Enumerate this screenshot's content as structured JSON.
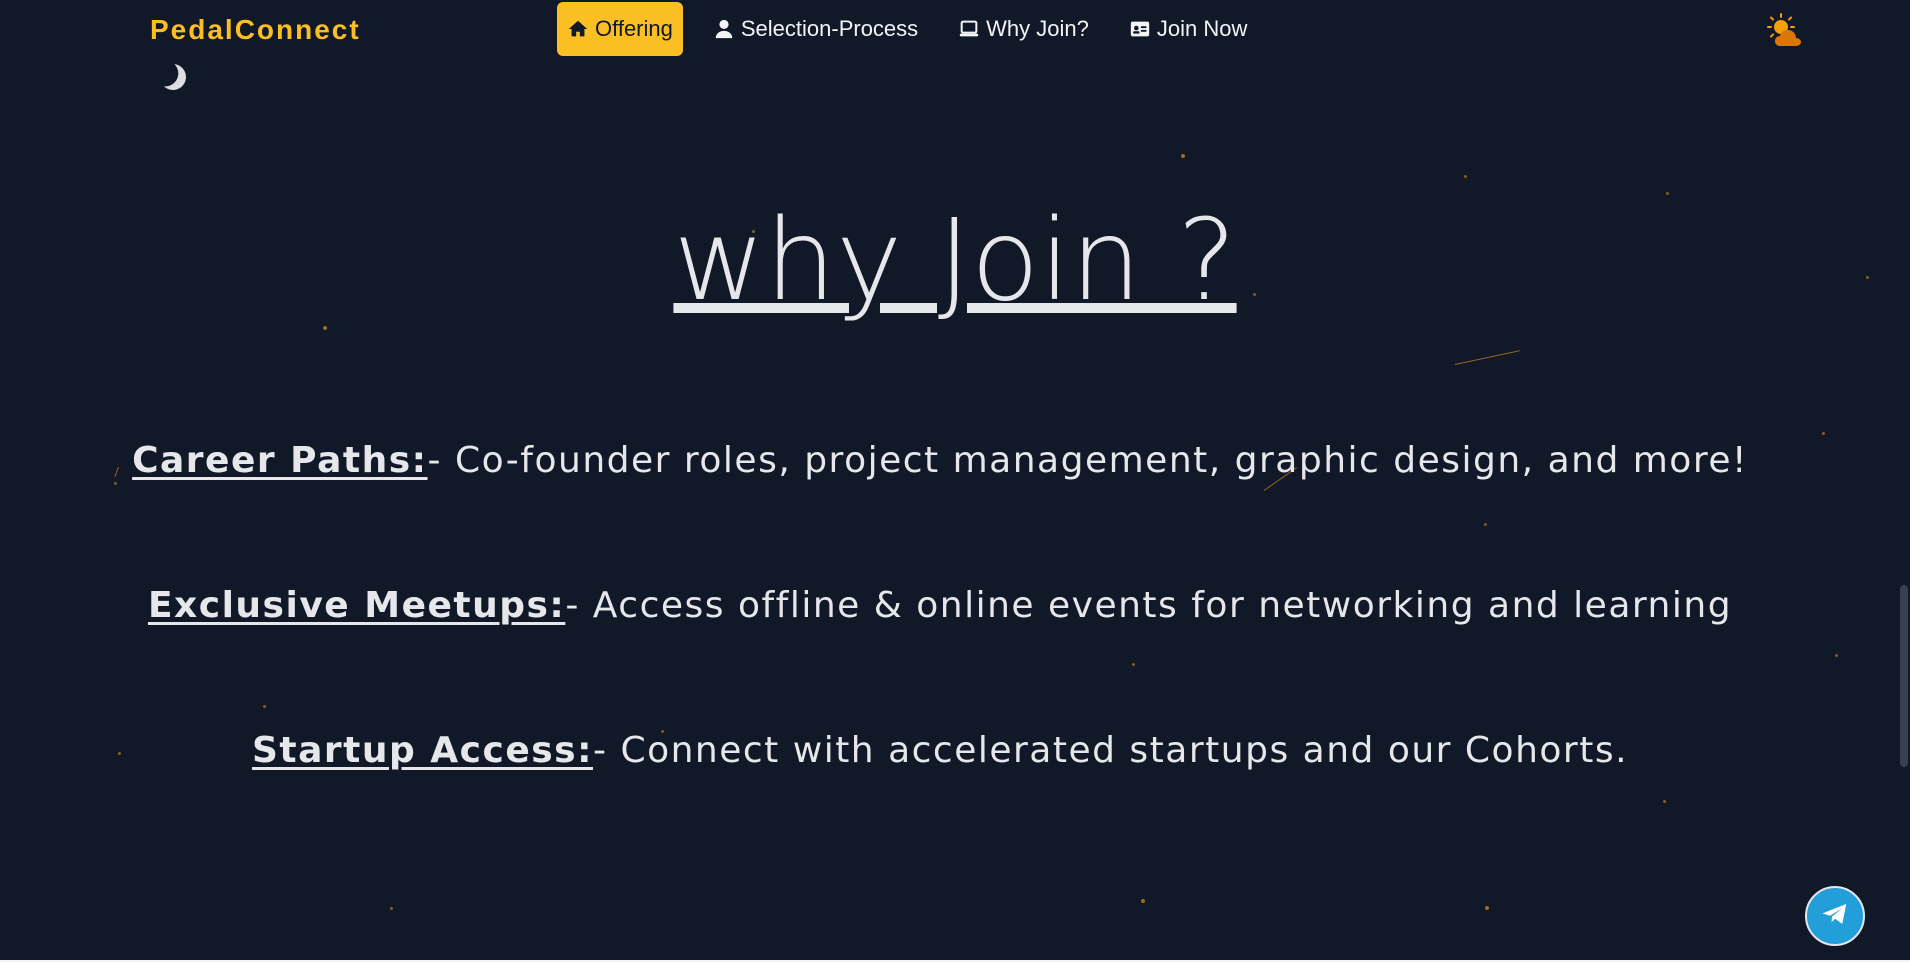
{
  "brand": {
    "name": "PedalConnect"
  },
  "nav": {
    "items": [
      {
        "label": "Offering",
        "icon": "home-icon",
        "active": true
      },
      {
        "label": "Selection-Process",
        "icon": "user-icon",
        "active": false
      },
      {
        "label": "Why Join?",
        "icon": "laptop-icon",
        "active": false
      },
      {
        "label": "Join Now",
        "icon": "id-card-icon",
        "active": false
      }
    ],
    "theme_icon": "sun-cloud-icon"
  },
  "section": {
    "title": "why Join ?",
    "features": [
      {
        "term": "Career Paths:",
        "text": "- Co-founder roles, project management, graphic design, and more!"
      },
      {
        "term": "Exclusive Meetups:",
        "text": "- Access offline & online events for networking and learning"
      },
      {
        "term": "Startup Access:",
        "text": "- Connect with accelerated startups and our Cohorts."
      }
    ]
  },
  "fab": {
    "icon": "telegram-icon"
  },
  "colors": {
    "background": "#111827",
    "accent": "#fbbf24",
    "text": "#e5e7eb",
    "telegram": "#229ed9",
    "star": "#b7791f"
  }
}
